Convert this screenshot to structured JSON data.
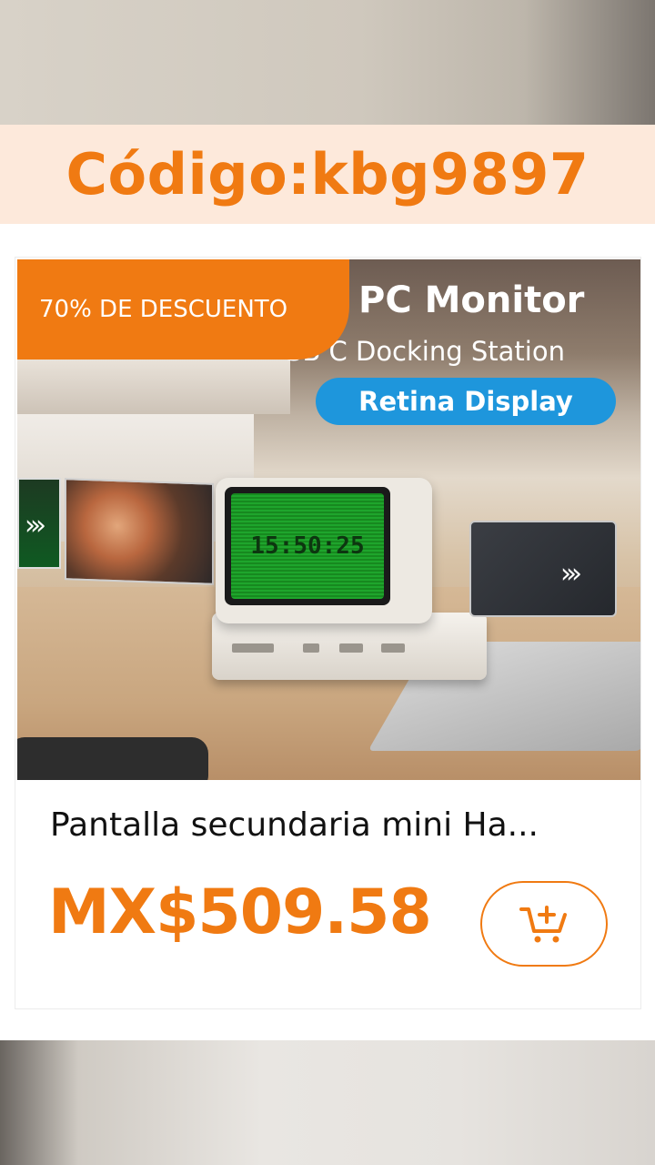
{
  "banner": {
    "code": "Código:kbg9897"
  },
  "product": {
    "discount_badge": "70% DE DESCUENTO",
    "image_headline": "PC Monitor",
    "image_subline": "SB C Docking Station",
    "image_pill": "Retina Display",
    "screen_clock": "15:50:25",
    "title": "Pantalla secundaria mini Ha...",
    "price": "MX$509.58"
  },
  "icons": {
    "cart": "add-to-cart-icon"
  },
  "colors": {
    "accent": "#f07a12",
    "pill": "#1e96dc",
    "banner_bg": "#fde9db"
  }
}
